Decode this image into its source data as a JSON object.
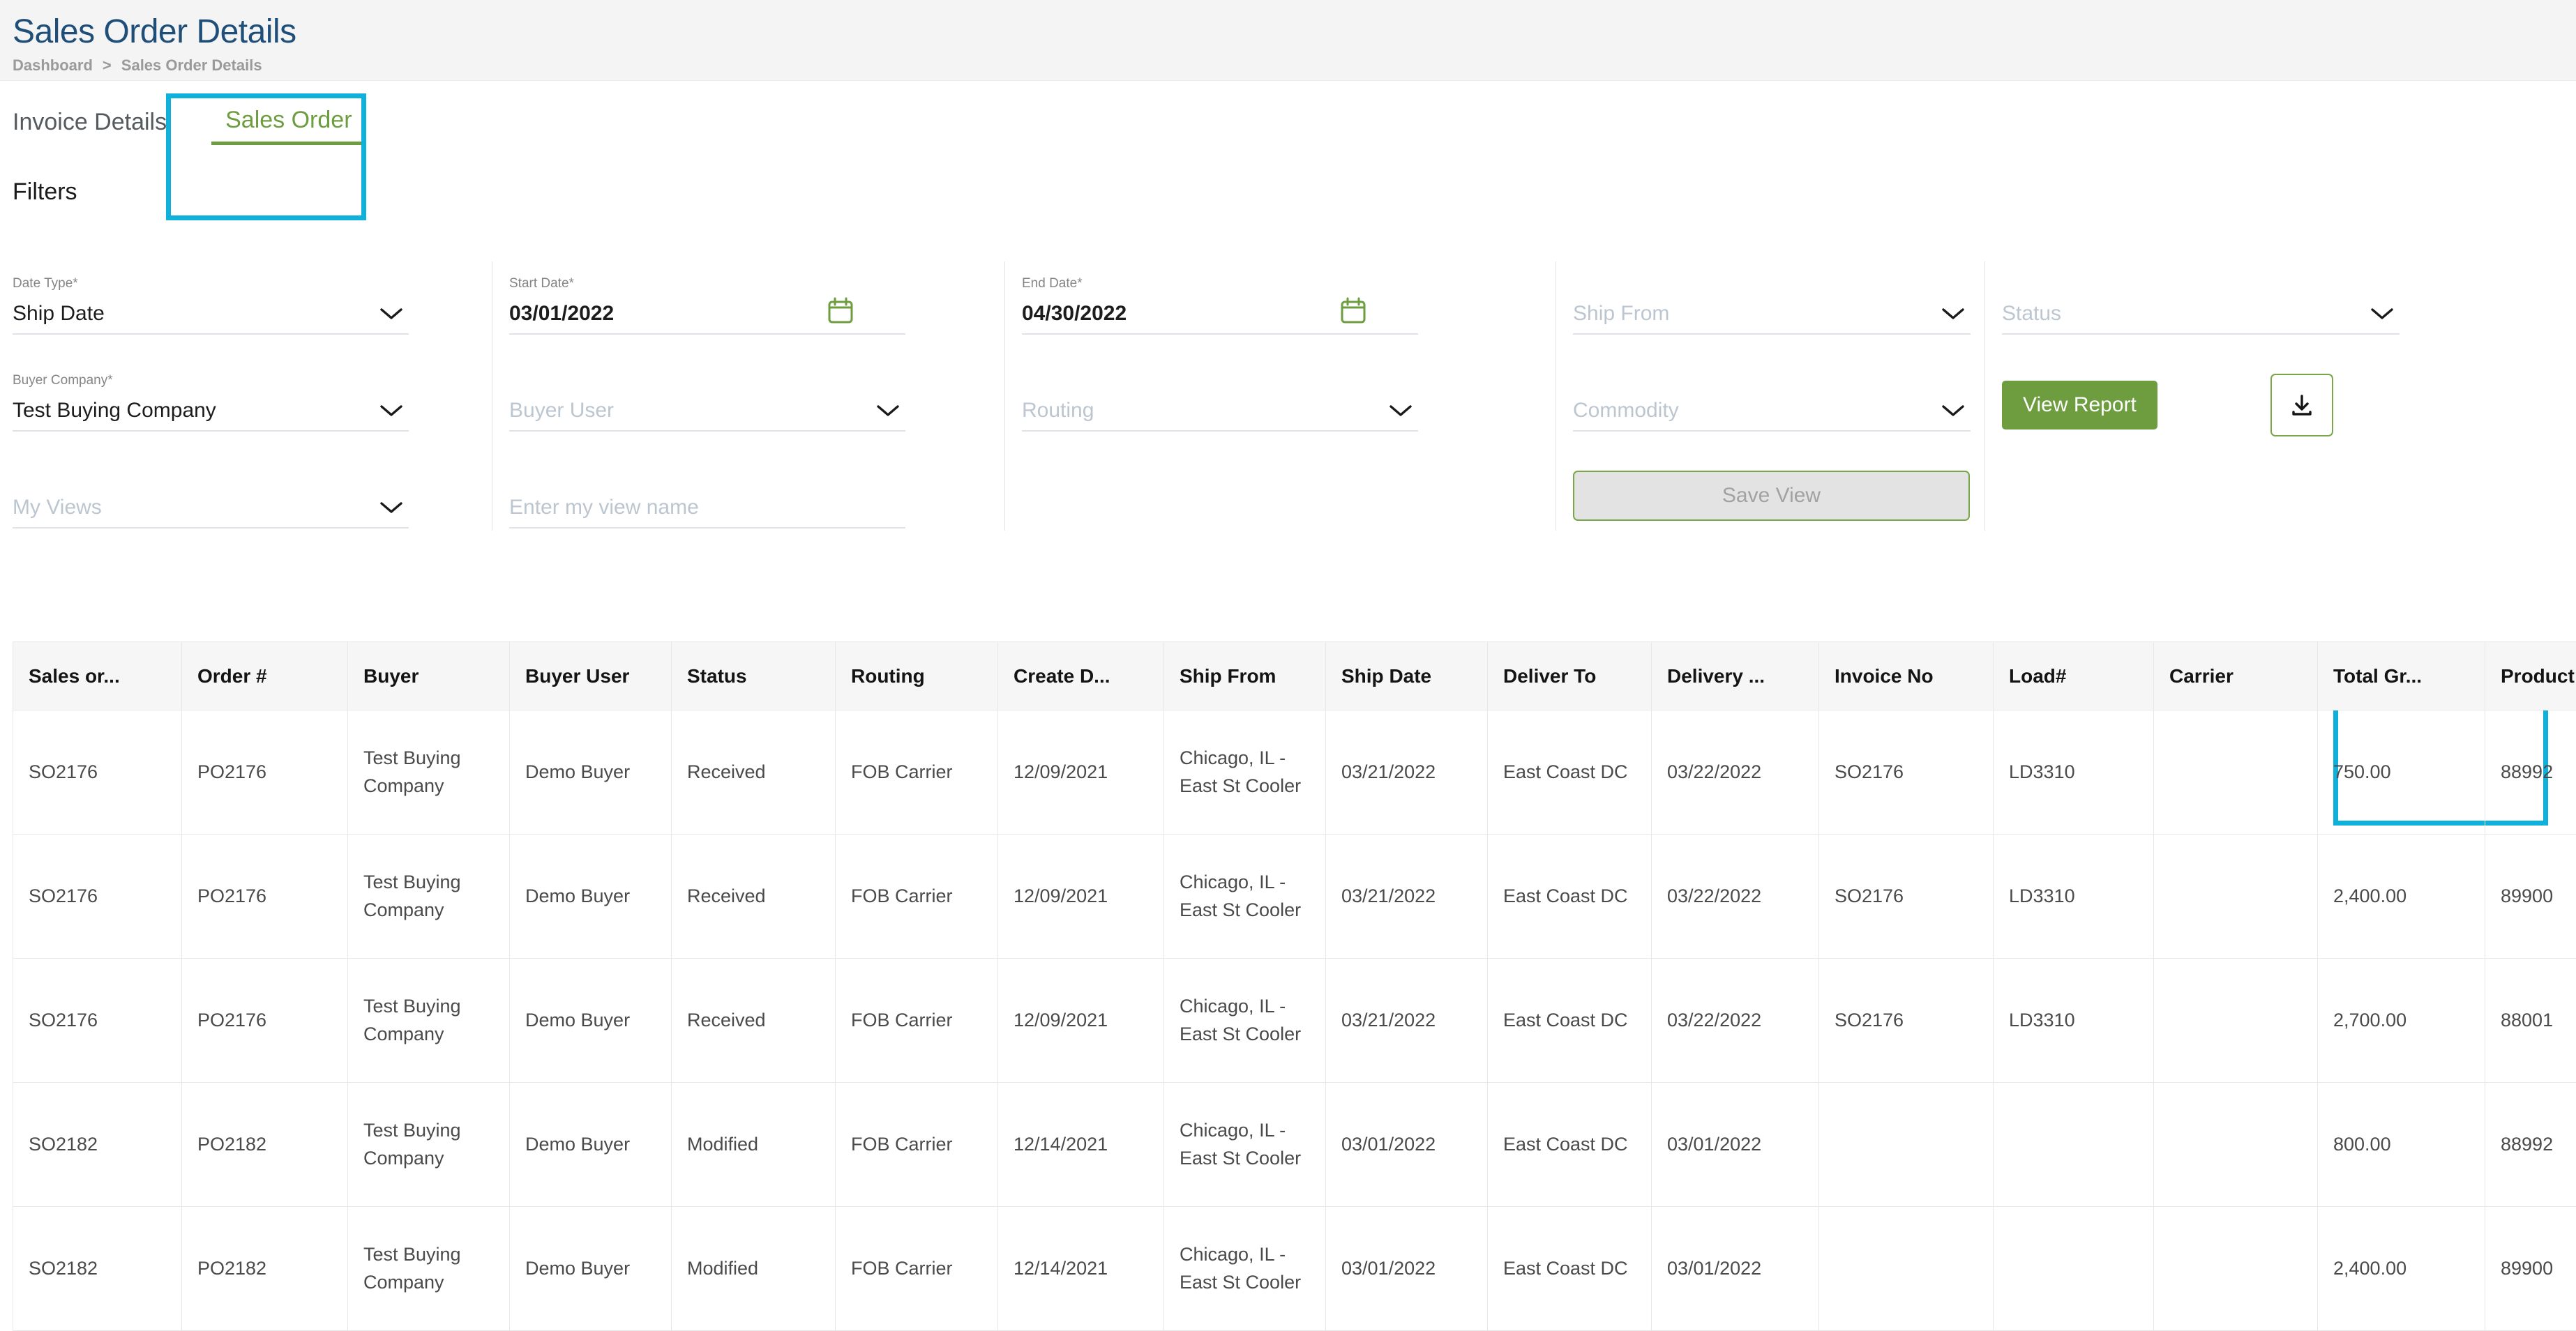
{
  "header": {
    "title": "Sales Order Details",
    "breadcrumb": {
      "root": "Dashboard",
      "separator": ">",
      "current": "Sales Order Details"
    }
  },
  "tabs": [
    {
      "label": "Invoice Details",
      "active": false
    },
    {
      "label": "Sales Order",
      "active": true
    }
  ],
  "filters": {
    "section_title": "Filters",
    "date_type": {
      "label": "Date Type*",
      "value": "Ship Date"
    },
    "buyer_company": {
      "label": "Buyer Company*",
      "value": "Test Buying Company"
    },
    "my_views": {
      "placeholder": "My Views"
    },
    "start_date": {
      "label": "Start Date*",
      "value": "03/01/2022"
    },
    "buyer_user": {
      "placeholder": "Buyer User"
    },
    "view_name": {
      "placeholder": "Enter my view name"
    },
    "end_date": {
      "label": "End Date*",
      "value": "04/30/2022"
    },
    "routing": {
      "placeholder": "Routing"
    },
    "ship_from": {
      "placeholder": "Ship From"
    },
    "commodity": {
      "placeholder": "Commodity"
    },
    "status": {
      "placeholder": "Status"
    },
    "save_view_label": "Save View",
    "view_report_label": "View Report"
  },
  "icons": {
    "calendar": "calendar-icon",
    "chevron_down": "chevron-down-icon",
    "download": "download-icon"
  },
  "colors": {
    "accent_green": "#6d9d3f",
    "title_blue": "#1f4e79",
    "annotation_cyan": "#0fb0da",
    "header_bg": "#f4f4f4"
  },
  "table": {
    "columns": [
      "Sales or...",
      "Order #",
      "Buyer",
      "Buyer User",
      "Status",
      "Routing",
      "Create D...",
      "Ship From",
      "Ship Date",
      "Deliver To",
      "Delivery ...",
      "Invoice No",
      "Load#",
      "Carrier",
      "Total Gr...",
      "Product ..."
    ],
    "rows": [
      [
        "SO2176",
        "PO2176",
        "Test Buying Company",
        "Demo Buyer",
        "Received",
        "FOB Carrier",
        "12/09/2021",
        "Chicago, IL - East St Cooler",
        "03/21/2022",
        "East Coast DC",
        "03/22/2022",
        "SO2176",
        "LD3310",
        "",
        "750.00",
        "88992"
      ],
      [
        "SO2176",
        "PO2176",
        "Test Buying Company",
        "Demo Buyer",
        "Received",
        "FOB Carrier",
        "12/09/2021",
        "Chicago, IL - East St Cooler",
        "03/21/2022",
        "East Coast DC",
        "03/22/2022",
        "SO2176",
        "LD3310",
        "",
        "2,400.00",
        "89900"
      ],
      [
        "SO2176",
        "PO2176",
        "Test Buying Company",
        "Demo Buyer",
        "Received",
        "FOB Carrier",
        "12/09/2021",
        "Chicago, IL - East St Cooler",
        "03/21/2022",
        "East Coast DC",
        "03/22/2022",
        "SO2176",
        "LD3310",
        "",
        "2,700.00",
        "88001"
      ],
      [
        "SO2182",
        "PO2182",
        "Test Buying Company",
        "Demo Buyer",
        "Modified",
        "FOB Carrier",
        "12/14/2021",
        "Chicago, IL - East St Cooler",
        "03/01/2022",
        "East Coast DC",
        "03/01/2022",
        "",
        "",
        "",
        "800.00",
        "88992"
      ],
      [
        "SO2182",
        "PO2182",
        "Test Buying Company",
        "Demo Buyer",
        "Modified",
        "FOB Carrier",
        "12/14/2021",
        "Chicago, IL - East St Cooler",
        "03/01/2022",
        "East Coast DC",
        "03/01/2022",
        "",
        "",
        "",
        "2,400.00",
        "89900"
      ]
    ]
  }
}
